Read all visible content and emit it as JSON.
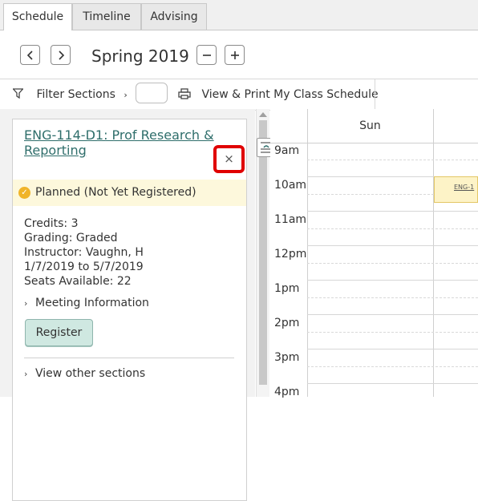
{
  "tabs": [
    {
      "label": "Schedule",
      "active": true
    },
    {
      "label": "Timeline",
      "active": false
    },
    {
      "label": "Advising",
      "active": false
    }
  ],
  "term": {
    "title": "Spring 2019",
    "prev_icon": "chevron-left",
    "next_icon": "chevron-right",
    "zoom_out_icon": "minus",
    "zoom_in_icon": "plus"
  },
  "toolbar": {
    "filter_label": "Filter Sections",
    "print_label": "View & Print My Class Schedule"
  },
  "course": {
    "title": "ENG-114-D1: Prof Research & Reporting",
    "remove_label": "×",
    "status": "Planned (Not Yet Registered)",
    "details": [
      "Credits: 3",
      "Grading: Graded",
      "Instructor: Vaughn, H",
      "1/7/2019 to 5/7/2019",
      "Seats Available:  22"
    ],
    "meeting_info_label": "Meeting Information",
    "register_label": "Register",
    "other_sections_label": "View other sections"
  },
  "calendar": {
    "day": "Sun",
    "times": [
      "9am",
      "10am",
      "11am",
      "12pm",
      "1pm",
      "2pm",
      "3pm",
      "4pm"
    ],
    "event_label": "ENG-1"
  },
  "colors": {
    "accent": "#2f6e6b",
    "highlight_border": "#e00000",
    "planned_bg": "#fdf8dc",
    "register_bg": "#cfe8e1",
    "event_bg": "#fdf3c7"
  }
}
